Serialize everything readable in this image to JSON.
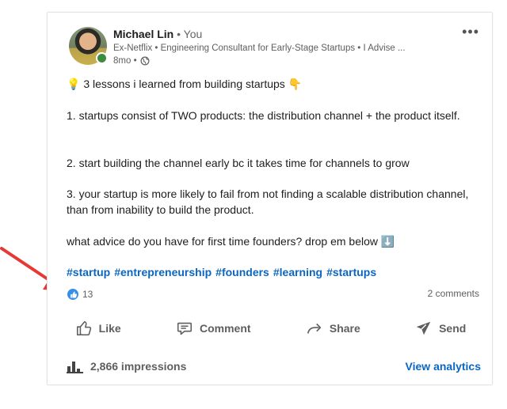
{
  "post": {
    "author": {
      "name": "Michael Lin",
      "relation": " • You",
      "headline": "Ex-Netflix • Engineering Consultant for Early-Stage Startups • I Advise ...",
      "time": "8mo •",
      "visibility_icon": "globe-icon"
    },
    "more_label": "•••",
    "body": {
      "line1": "💡 3 lessons i learned from building startups 👇",
      "line2": "1. startups consist of TWO products: the distribution channel + the product itself.",
      "line3": "2. start building the channel early bc it takes time for channels to grow",
      "line4": "3. your startup is more likely to fail from not finding a scalable distribution channel, than from inability to build the product.",
      "line5": "what advice do you have for first time founders? drop em below ⬇️"
    },
    "hashtags": [
      "#startup",
      "#entrepreneurship",
      "#founders",
      "#learning",
      "#startups"
    ],
    "reaction_count": "13",
    "comments_count": "2 comments",
    "actions": {
      "like": "Like",
      "comment": "Comment",
      "share": "Share",
      "send": "Send"
    },
    "impressions": "2,866 impressions",
    "view_analytics": "View analytics"
  },
  "colors": {
    "accent": "#0a66c2",
    "annotation_arrow": "#e53935",
    "online": "#3e8a3f"
  }
}
